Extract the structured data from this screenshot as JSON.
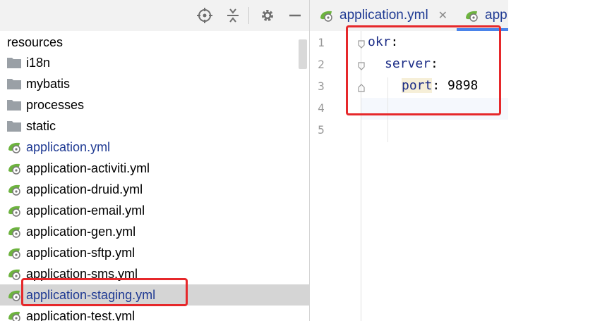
{
  "project_tree": {
    "root_label": "resources",
    "items": [
      {
        "label": "i18n",
        "icon": "folder-icon",
        "kind": "folder"
      },
      {
        "label": "mybatis",
        "icon": "folder-icon",
        "kind": "folder"
      },
      {
        "label": "processes",
        "icon": "folder-icon",
        "kind": "folder"
      },
      {
        "label": "static",
        "icon": "folder-icon",
        "kind": "folder"
      },
      {
        "label": "application.yml",
        "icon": "spring-yaml-icon",
        "kind": "file"
      },
      {
        "label": "application-activiti.yml",
        "icon": "spring-yaml-icon",
        "kind": "file"
      },
      {
        "label": "application-druid.yml",
        "icon": "spring-yaml-icon",
        "kind": "file"
      },
      {
        "label": "application-email.yml",
        "icon": "spring-yaml-icon",
        "kind": "file"
      },
      {
        "label": "application-gen.yml",
        "icon": "spring-yaml-icon",
        "kind": "file"
      },
      {
        "label": "application-sftp.yml",
        "icon": "spring-yaml-icon",
        "kind": "file"
      },
      {
        "label": "application-sms.yml",
        "icon": "spring-yaml-icon",
        "kind": "file"
      },
      {
        "label": "application-staging.yml",
        "icon": "spring-yaml-icon",
        "kind": "file",
        "selected": true
      },
      {
        "label": "application-test.yml",
        "icon": "spring-yaml-icon",
        "kind": "file"
      }
    ]
  },
  "toolbar": {
    "icons": [
      "crosshair-icon",
      "collapse-all-icon",
      "gear-icon",
      "minimize-icon"
    ]
  },
  "editor": {
    "tabs": [
      {
        "label": "application.yml",
        "icon": "spring-yaml-icon",
        "close": "✕"
      },
      {
        "label": "app",
        "icon": "spring-yaml-icon"
      }
    ],
    "line_numbers": [
      "1",
      "2",
      "3",
      "4",
      "5"
    ],
    "code": {
      "line1_key": "okr",
      "line2_key": "server",
      "line3_key": "port",
      "line3_value": "9898",
      "colon": ":"
    }
  },
  "colors": {
    "highlight_box": "#e6282b",
    "yaml_key": "#1b2c86",
    "selected_row": "#d5d5d5",
    "file_label_blue": "#1f3a93"
  }
}
